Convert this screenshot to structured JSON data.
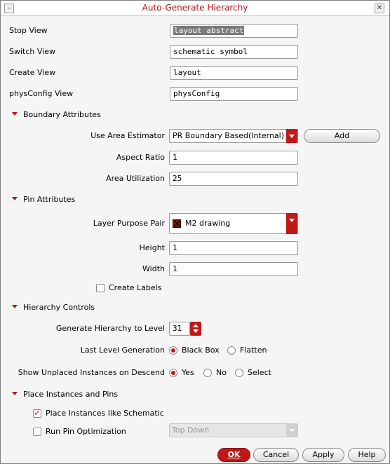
{
  "window": {
    "title": "Auto-Generate Hierarchy",
    "minimize_glyph": "–",
    "close_glyph": "✕"
  },
  "views": {
    "stop_view": {
      "label": "Stop View",
      "value": "layout abstract"
    },
    "switch_view": {
      "label": "Switch View",
      "value": "schematic symbol"
    },
    "create_view": {
      "label": "Create View",
      "value": "layout"
    },
    "physconfig_view": {
      "label": "physConfig View",
      "value": "physConfig"
    }
  },
  "boundary": {
    "section_label": "Boundary Attributes",
    "area_estimator": {
      "label": "Use Area Estimator",
      "value": "PR Boundary Based(Internal)",
      "add_label": "Add"
    },
    "aspect_ratio": {
      "label": "Aspect Ratio",
      "value": "1"
    },
    "area_utilization": {
      "label": "Area Utilization",
      "value": "25"
    }
  },
  "pin": {
    "section_label": "Pin Attributes",
    "layer_purpose": {
      "label": "Layer Purpose Pair",
      "value": "M2 drawing",
      "swatch_color": "#7a1010"
    },
    "height": {
      "label": "Height",
      "value": "1"
    },
    "width": {
      "label": "Width",
      "value": "1"
    },
    "create_labels": {
      "label": "Create Labels",
      "checked": false
    }
  },
  "hierarchy": {
    "section_label": "Hierarchy Controls",
    "generate_level": {
      "label": "Generate Hierarchy to Level",
      "value": "31"
    },
    "last_level": {
      "label": "Last Level Generation",
      "options": [
        {
          "label": "Black Box",
          "selected": true
        },
        {
          "label": "Flatten",
          "selected": false
        }
      ]
    },
    "show_unplaced": {
      "label": "Show Unplaced Instances on Descend",
      "options": [
        {
          "label": "Yes",
          "selected": true
        },
        {
          "label": "No",
          "selected": false
        },
        {
          "label": "Select",
          "selected": false
        }
      ]
    }
  },
  "place": {
    "section_label": "Place Instances and Pins",
    "place_like_schematic": {
      "label": "Place Instances like Schematic",
      "checked": true
    },
    "run_pin_opt": {
      "label": "Run Pin Optimization",
      "checked": false
    },
    "pin_opt_mode": "Top Down"
  },
  "buttons": {
    "ok": "OK",
    "cancel": "Cancel",
    "apply": "Apply",
    "help": "Help"
  },
  "colors": {
    "accent": "#c01818",
    "title_text": "#b01818"
  }
}
